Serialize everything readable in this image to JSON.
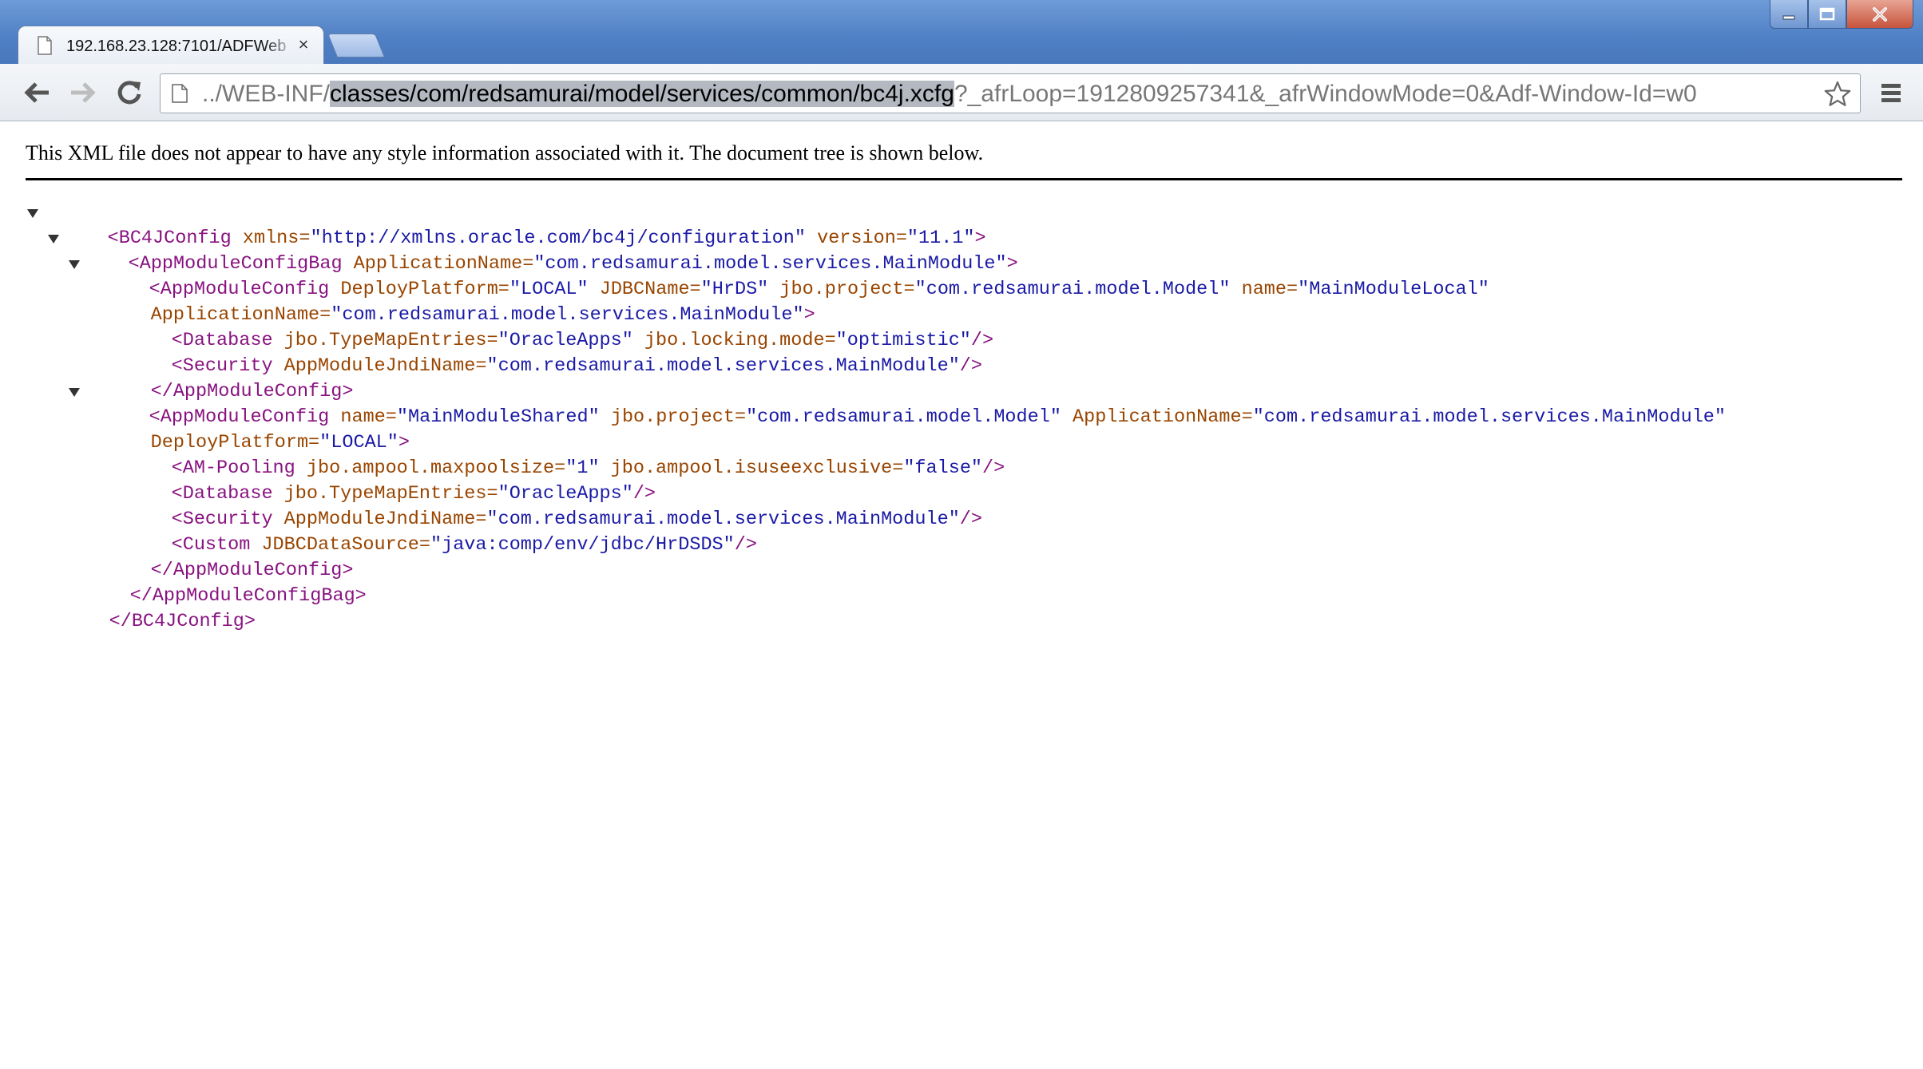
{
  "tab": {
    "title": "192.168.23.128:7101/ADFWeb",
    "close_glyph": "×"
  },
  "omnibox": {
    "url_prefix": "../WEB-INF/",
    "url_selected": "classes/com/redsamurai/model/services/common/bc4j.xcfg",
    "url_suffix": "?_afrLoop=1912809257341&_afrWindowMode=0&Adf-Window-Id=w0"
  },
  "icons": {
    "back": "back-arrow-icon",
    "forward": "forward-arrow-icon",
    "reload": "reload-icon",
    "page": "page-icon",
    "star": "star-icon",
    "menu": "menu-icon"
  },
  "notice": "This XML file does not appear to have any style information associated with it. The document tree is shown below.",
  "xml": {
    "l1": {
      "open": "<BC4JConfig",
      "a1": " xmlns=",
      "v1": "\"http://xmlns.oracle.com/bc4j/configuration\"",
      "a2": " version=",
      "v2": "\"11.1\"",
      "close": ">"
    },
    "l2": {
      "open": "<AppModuleConfigBag",
      "a1": " ApplicationName=",
      "v1": "\"com.redsamurai.model.services.MainModule\"",
      "close": ">"
    },
    "l3": {
      "open": "<AppModuleConfig",
      "a1": " DeployPlatform=",
      "v1": "\"LOCAL\"",
      "a2": " JDBCName=",
      "v2": "\"HrDS\"",
      "a3": " jbo.project=",
      "v3": "\"com.redsamurai.model.Model\"",
      "a4": " name=",
      "v4": "\"MainModuleLocal\""
    },
    "l4": {
      "a1": "ApplicationName=",
      "v1": "\"com.redsamurai.model.services.MainModule\"",
      "close": ">"
    },
    "l5": {
      "open": "<Database",
      "a1": " jbo.TypeMapEntries=",
      "v1": "\"OracleApps\"",
      "a2": " jbo.locking.mode=",
      "v2": "\"optimistic\"",
      "close": "/>"
    },
    "l6": {
      "open": "<Security",
      "a1": " AppModuleJndiName=",
      "v1": "\"com.redsamurai.model.services.MainModule\"",
      "close": "/>"
    },
    "l7": {
      "close": "</AppModuleConfig>"
    },
    "l8": {
      "open": "<AppModuleConfig",
      "a1": " name=",
      "v1": "\"MainModuleShared\"",
      "a2": " jbo.project=",
      "v2": "\"com.redsamurai.model.Model\"",
      "a3": " ApplicationName=",
      "v3": "\"com.redsamurai.model.services.MainModule\""
    },
    "l9": {
      "a1": "DeployPlatform=",
      "v1": "\"LOCAL\"",
      "close": ">"
    },
    "l10": {
      "open": "<AM-Pooling",
      "a1": " jbo.ampool.maxpoolsize=",
      "v1": "\"1\"",
      "a2": " jbo.ampool.isuseexclusive=",
      "v2": "\"false\"",
      "close": "/>"
    },
    "l11": {
      "open": "<Database",
      "a1": " jbo.TypeMapEntries=",
      "v1": "\"OracleApps\"",
      "close": "/>"
    },
    "l12": {
      "open": "<Security",
      "a1": " AppModuleJndiName=",
      "v1": "\"com.redsamurai.model.services.MainModule\"",
      "close": "/>"
    },
    "l13": {
      "open": "<Custom",
      "a1": " JDBCDataSource=",
      "v1": "\"java:comp/env/jdbc/HrDSDS\"",
      "close": "/>"
    },
    "l14": {
      "close": "</AppModuleConfig>"
    },
    "l15": {
      "close": "</AppModuleConfigBag>"
    },
    "l16": {
      "close": "</BC4JConfig>"
    }
  }
}
